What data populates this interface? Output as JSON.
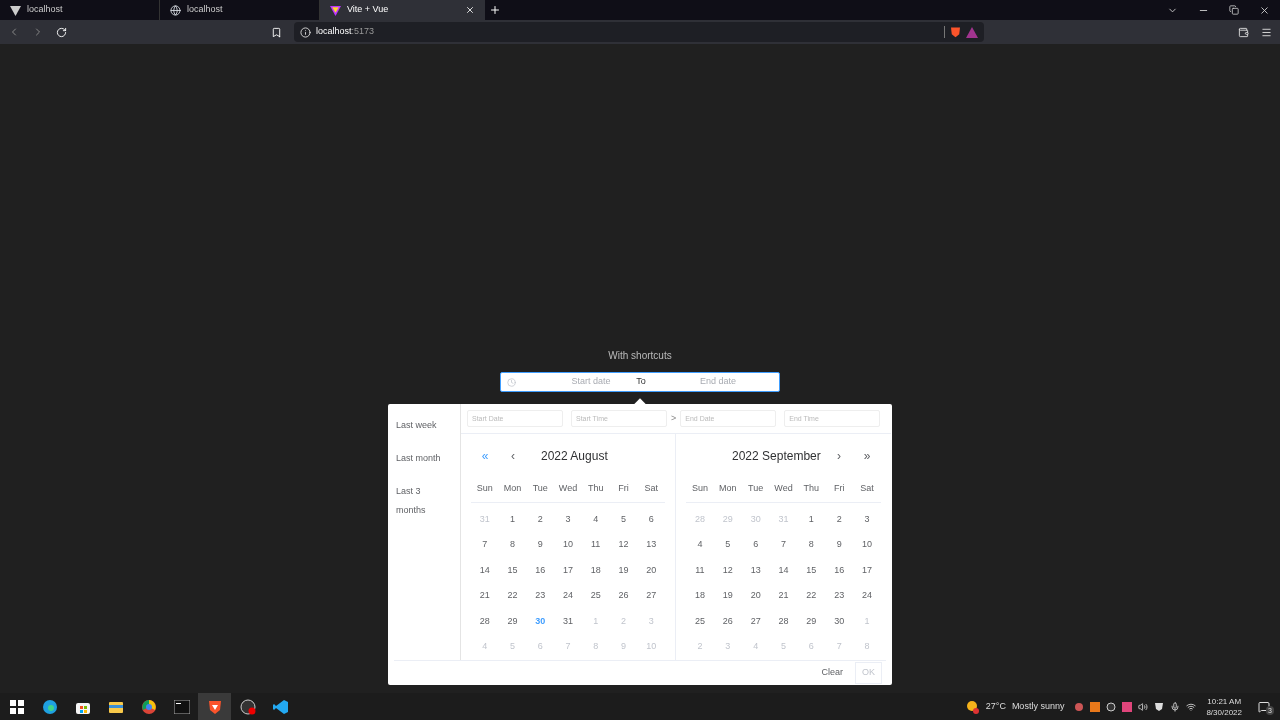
{
  "browser": {
    "tabs": [
      {
        "title": "localhost",
        "selected": false
      },
      {
        "title": "localhost",
        "selected": false
      },
      {
        "title": "Vite + Vue",
        "selected": true
      }
    ],
    "url_host": "localhost",
    "url_port": ":5173"
  },
  "picker": {
    "label": "With shortcuts",
    "start_placeholder": "Start date",
    "separator": "To",
    "end_placeholder": "End date",
    "shortcuts": [
      "Last week",
      "Last month",
      "Last 3 months"
    ],
    "fields": [
      {
        "placeholder": "Start Date"
      },
      {
        "placeholder": "Start Time"
      },
      {
        "placeholder": "End Date"
      },
      {
        "placeholder": "End Time"
      }
    ],
    "fields_arrow": ">",
    "months": [
      {
        "title": "2022 August",
        "nav": [
          "«",
          "‹"
        ],
        "weekdays": [
          "Sun",
          "Mon",
          "Tue",
          "Wed",
          "Thu",
          "Fri",
          "Sat"
        ],
        "days": [
          {
            "d": "31",
            "kind": "muted"
          },
          {
            "d": "1",
            "kind": "normal"
          },
          {
            "d": "2",
            "kind": "normal"
          },
          {
            "d": "3",
            "kind": "normal"
          },
          {
            "d": "4",
            "kind": "normal"
          },
          {
            "d": "5",
            "kind": "normal"
          },
          {
            "d": "6",
            "kind": "normal"
          },
          {
            "d": "7",
            "kind": "normal"
          },
          {
            "d": "8",
            "kind": "normal"
          },
          {
            "d": "9",
            "kind": "normal"
          },
          {
            "d": "10",
            "kind": "normal"
          },
          {
            "d": "11",
            "kind": "normal"
          },
          {
            "d": "12",
            "kind": "normal"
          },
          {
            "d": "13",
            "kind": "normal"
          },
          {
            "d": "14",
            "kind": "normal"
          },
          {
            "d": "15",
            "kind": "normal"
          },
          {
            "d": "16",
            "kind": "normal"
          },
          {
            "d": "17",
            "kind": "normal"
          },
          {
            "d": "18",
            "kind": "normal"
          },
          {
            "d": "19",
            "kind": "normal"
          },
          {
            "d": "20",
            "kind": "normal"
          },
          {
            "d": "21",
            "kind": "normal"
          },
          {
            "d": "22",
            "kind": "normal"
          },
          {
            "d": "23",
            "kind": "normal"
          },
          {
            "d": "24",
            "kind": "normal"
          },
          {
            "d": "25",
            "kind": "normal"
          },
          {
            "d": "26",
            "kind": "normal"
          },
          {
            "d": "27",
            "kind": "normal"
          },
          {
            "d": "28",
            "kind": "normal"
          },
          {
            "d": "29",
            "kind": "normal"
          },
          {
            "d": "30",
            "kind": "today"
          },
          {
            "d": "31",
            "kind": "normal"
          },
          {
            "d": "1",
            "kind": "muted"
          },
          {
            "d": "2",
            "kind": "muted"
          },
          {
            "d": "3",
            "kind": "muted"
          },
          {
            "d": "4",
            "kind": "muted"
          },
          {
            "d": "5",
            "kind": "muted"
          },
          {
            "d": "6",
            "kind": "muted"
          },
          {
            "d": "7",
            "kind": "muted"
          },
          {
            "d": "8",
            "kind": "muted"
          },
          {
            "d": "9",
            "kind": "muted"
          },
          {
            "d": "10",
            "kind": "muted"
          }
        ]
      },
      {
        "title": "2022 September",
        "nav": [
          "›",
          "»"
        ],
        "weekdays": [
          "Sun",
          "Mon",
          "Tue",
          "Wed",
          "Thu",
          "Fri",
          "Sat"
        ],
        "days": [
          {
            "d": "28",
            "kind": "muted"
          },
          {
            "d": "29",
            "kind": "muted"
          },
          {
            "d": "30",
            "kind": "muted"
          },
          {
            "d": "31",
            "kind": "muted"
          },
          {
            "d": "1",
            "kind": "normal"
          },
          {
            "d": "2",
            "kind": "normal"
          },
          {
            "d": "3",
            "kind": "normal"
          },
          {
            "d": "4",
            "kind": "normal"
          },
          {
            "d": "5",
            "kind": "normal"
          },
          {
            "d": "6",
            "kind": "normal"
          },
          {
            "d": "7",
            "kind": "normal"
          },
          {
            "d": "8",
            "kind": "normal"
          },
          {
            "d": "9",
            "kind": "normal"
          },
          {
            "d": "10",
            "kind": "normal"
          },
          {
            "d": "11",
            "kind": "normal"
          },
          {
            "d": "12",
            "kind": "normal"
          },
          {
            "d": "13",
            "kind": "normal"
          },
          {
            "d": "14",
            "kind": "normal"
          },
          {
            "d": "15",
            "kind": "normal"
          },
          {
            "d": "16",
            "kind": "normal"
          },
          {
            "d": "17",
            "kind": "normal"
          },
          {
            "d": "18",
            "kind": "normal"
          },
          {
            "d": "19",
            "kind": "normal"
          },
          {
            "d": "20",
            "kind": "normal"
          },
          {
            "d": "21",
            "kind": "normal"
          },
          {
            "d": "22",
            "kind": "normal"
          },
          {
            "d": "23",
            "kind": "normal"
          },
          {
            "d": "24",
            "kind": "normal"
          },
          {
            "d": "25",
            "kind": "normal"
          },
          {
            "d": "26",
            "kind": "normal"
          },
          {
            "d": "27",
            "kind": "normal"
          },
          {
            "d": "28",
            "kind": "normal"
          },
          {
            "d": "29",
            "kind": "normal"
          },
          {
            "d": "30",
            "kind": "normal"
          },
          {
            "d": "1",
            "kind": "muted"
          },
          {
            "d": "2",
            "kind": "muted"
          },
          {
            "d": "3",
            "kind": "muted"
          },
          {
            "d": "4",
            "kind": "muted"
          },
          {
            "d": "5",
            "kind": "muted"
          },
          {
            "d": "6",
            "kind": "muted"
          },
          {
            "d": "7",
            "kind": "muted"
          },
          {
            "d": "8",
            "kind": "muted"
          }
        ]
      }
    ],
    "clear": "Clear",
    "ok": "OK"
  },
  "taskbar": {
    "apps": [
      {
        "selected": false
      },
      {
        "selected": false
      },
      {
        "selected": false
      },
      {
        "selected": false
      },
      {
        "selected": false
      },
      {
        "selected": false
      },
      {
        "selected": true
      },
      {
        "selected": false
      },
      {
        "selected": false
      }
    ],
    "temperature": "27°C",
    "weather": "Mostly sunny",
    "time": "10:21 AM",
    "date": "8/30/2022",
    "notifications": "3"
  }
}
